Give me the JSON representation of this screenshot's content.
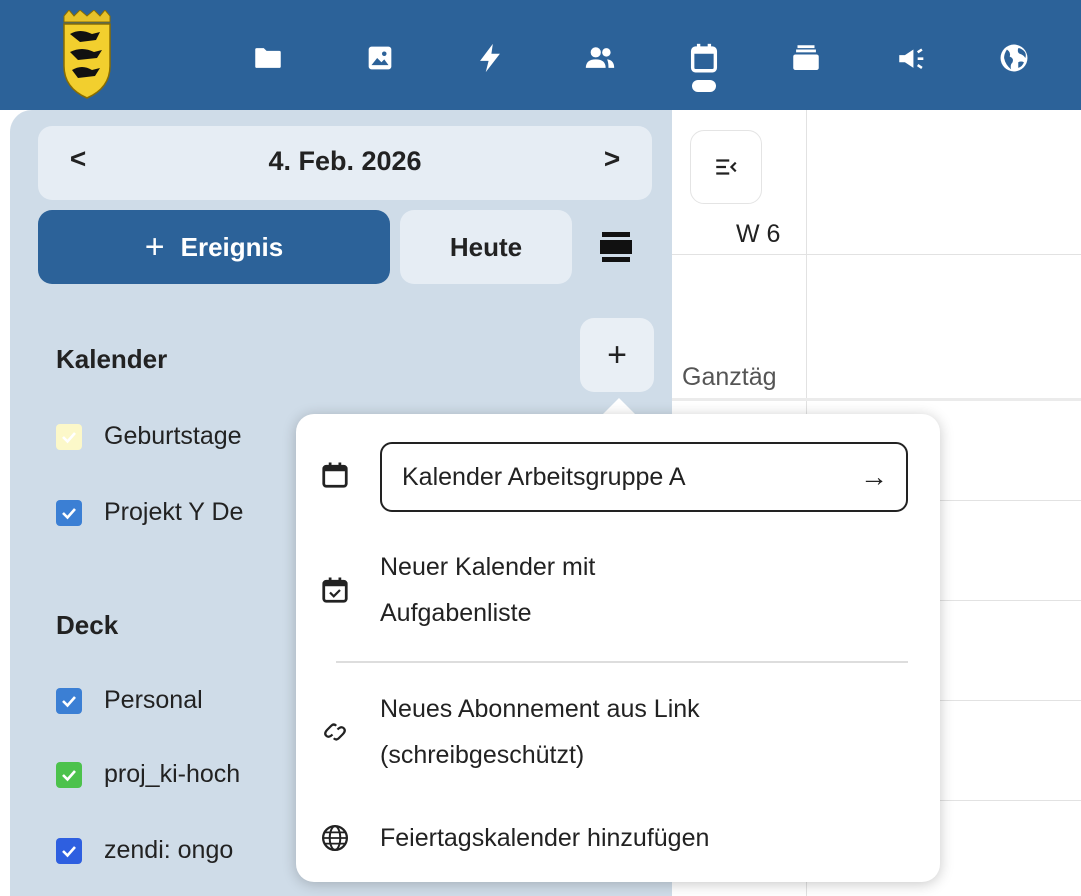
{
  "topbar": {
    "background": "#2c6299",
    "logo": "baden-wuerttemberg-coat-of-arms",
    "nav_icons": [
      "folder-icon",
      "image-icon",
      "activity-icon",
      "contacts-icon",
      "calendar-icon",
      "deck-icon",
      "announcement-icon",
      "globe-icon"
    ],
    "active_icon": "calendar-icon"
  },
  "sidebar": {
    "date_label": "4. Feb. 2026",
    "prev_icon": "<",
    "next_icon": ">",
    "new_event_plus": "+",
    "new_event_label": "Ereignis",
    "today_label": "Heute",
    "add_calendar_plus": "+",
    "calendars_heading": "Kalender",
    "calendars": [
      {
        "label": "Geburtstage",
        "color": "#fcf8c9"
      },
      {
        "label": "Projekt Y De",
        "color": "#3b7fd4"
      }
    ],
    "deck_heading": "Deck",
    "deck_items": [
      {
        "label": "Personal",
        "color": "#3b7fd4"
      },
      {
        "label": "proj_ki-hoch",
        "color": "#4cc24c"
      },
      {
        "label": "zendi: ongo",
        "color": "#2e5fe0"
      }
    ]
  },
  "main": {
    "week_label": "W 6",
    "allday_label": "Ganztäg"
  },
  "popover": {
    "new_calendar_value": "Kalender Arbeitsgruppe A",
    "new_calendar_submit": "→",
    "task_calendar_line1": "Neuer Kalender mit",
    "task_calendar_line2": "Aufgabenliste",
    "subscription_line1": "Neues Abonnement aus Link",
    "subscription_line2": "(schreibgeschützt)",
    "holiday_label": "Feiertagskalender hinzufügen"
  }
}
